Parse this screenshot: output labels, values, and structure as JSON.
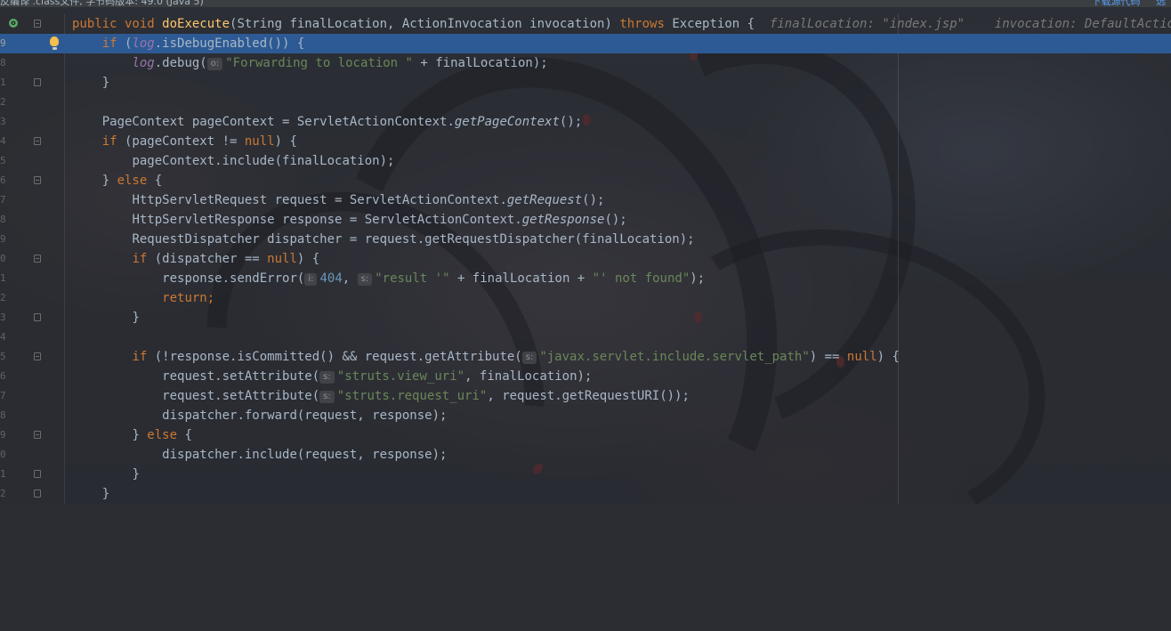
{
  "topbar": {
    "info": "反编译 .class文件, 字节码版本: 49.0 (Java 5)",
    "download_sources": "下载源代码",
    "choose_sources": "选"
  },
  "gutter": {
    "line_numbers": [
      "",
      "9",
      "8",
      "1",
      "2",
      "3",
      "4",
      "5",
      "6",
      "7",
      "8",
      "9",
      "0",
      "1",
      "2",
      "3",
      "4",
      "5",
      "6",
      "7",
      "8",
      "9",
      "0",
      "1",
      "2"
    ]
  },
  "code": {
    "l0": {
      "kw1": "public void ",
      "fn": "doExecute",
      "rest": "(String finalLocation, ActionInvocation invocation) ",
      "kw2": "throws",
      "rest2": " Exception {",
      "inline1": "finalLocation: \"index.jsp\"",
      "inline2": "invocation: DefaultActionInvoca"
    },
    "l1": {
      "kw": "if",
      "a": " (",
      "log": "log",
      ".b": ".isDebugEnabled()) {"
    },
    "l2": {
      "log": "log",
      "a": ".debug(",
      "hint": "o:",
      "str": "\"Forwarding to location \"",
      "b": " + finalLocation);"
    },
    "l3": {
      "a": "}"
    },
    "l5": {
      "a": "PageContext pageContext = ServletActionContext.",
      "it": "getPageContext",
      "b": "();"
    },
    "l6": {
      "kw": "if",
      "a": " (pageContext != ",
      "kw2": "null",
      "b": ") {"
    },
    "l7": {
      "a": "pageContext.include(finalLocation);"
    },
    "l8": {
      "a": "} ",
      "kw": "else",
      "b": " {"
    },
    "l9": {
      "a": "HttpServletRequest request = ServletActionContext.",
      "it": "getRequest",
      "b": "();"
    },
    "l10": {
      "a": "HttpServletResponse response = ServletActionContext.",
      "it": "getResponse",
      "b": "();"
    },
    "l11": {
      "a": "RequestDispatcher dispatcher = request.getRequestDispatcher(finalLocation);"
    },
    "l12": {
      "kw": "if",
      "a": " (dispatcher == ",
      "kw2": "null",
      "b": ") {"
    },
    "l13": {
      "a": "response.sendError(",
      "hint1": "i:",
      "num": "404",
      ",": ", ",
      "hint2": "s:",
      "str1": "\"result '\"",
      "b": " + finalLocation + ",
      "str2": "\"' not found\"",
      "c": ");"
    },
    "l14": {
      "kw": "return",
      ";": ";"
    },
    "l15": {
      "a": "}"
    },
    "l17": {
      "kw": "if",
      "a": " (!response.isCommitted() && request.getAttribute(",
      "hint": "s:",
      "str": "\"javax.servlet.include.servlet_path\"",
      "b": ") == ",
      "kw2": "null",
      "c": ") {"
    },
    "l18": {
      "a": "request.setAttribute(",
      "hint": "s:",
      "str": "\"struts.view_uri\"",
      "b": ", finalLocation);"
    },
    "l19": {
      "a": "request.setAttribute(",
      "hint": "s:",
      "str": "\"struts.request_uri\"",
      "b": ", request.getRequestURI());"
    },
    "l20": {
      "a": "dispatcher.forward(request, response);"
    },
    "l21": {
      "a": "} ",
      "kw": "else",
      "b": " {"
    },
    "l22": {
      "a": "dispatcher.include(request, response);"
    },
    "l23": {
      "a": "}"
    },
    "l24": {
      "a": "}"
    }
  },
  "icons": {
    "override": "override-method-icon",
    "bulb": "intention-bulb-icon"
  },
  "colors": {
    "keyword": "#cc7832",
    "string": "#6a8759",
    "number": "#6897bb",
    "function": "#ffc66d",
    "static_field": "#9876aa",
    "current_line": "#2d5a94"
  }
}
